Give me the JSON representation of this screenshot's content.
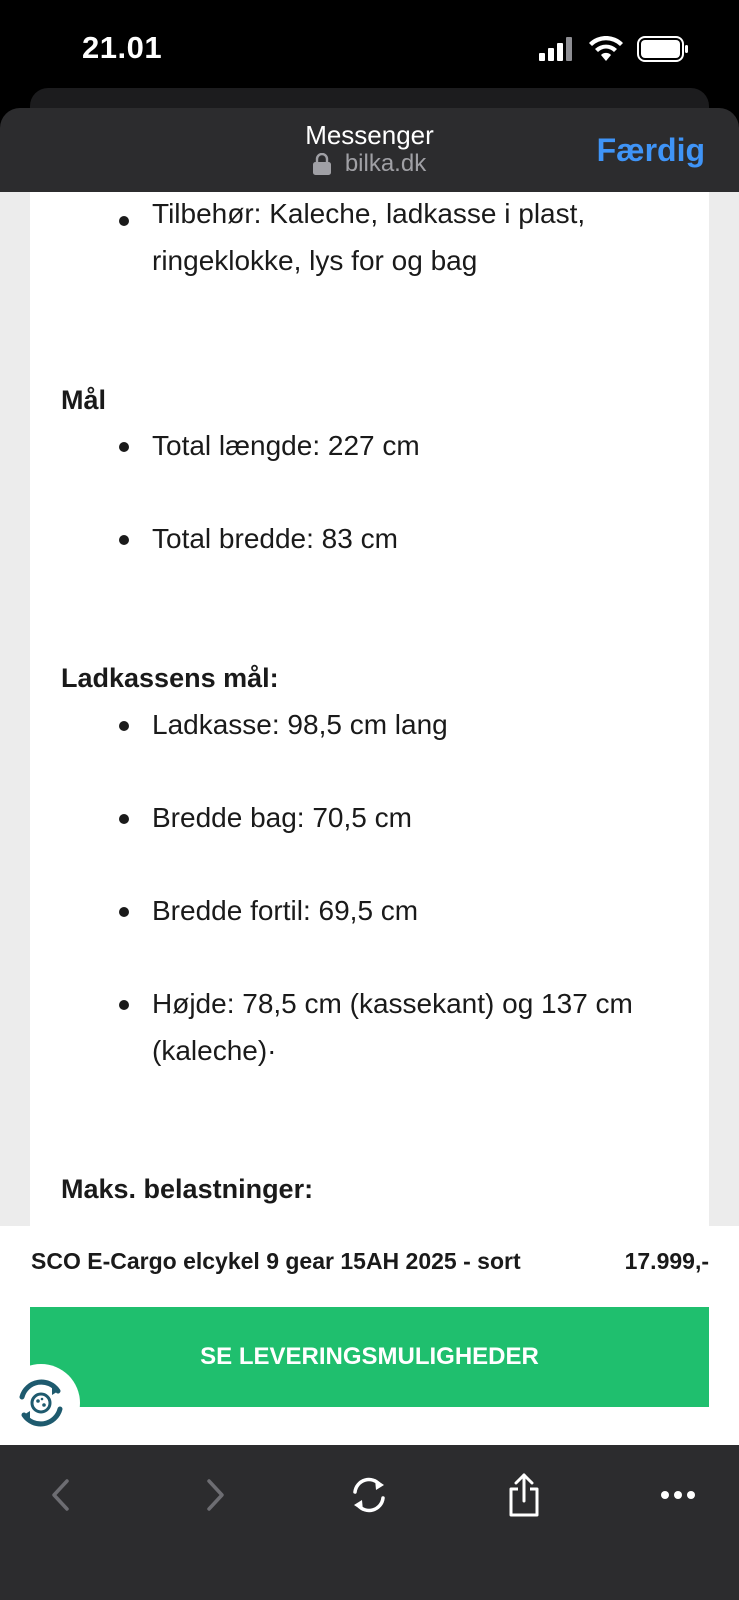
{
  "status_bar": {
    "time": "21.01"
  },
  "browser": {
    "title": "Messenger",
    "url": "bilka.dk",
    "done_label": "Færdig"
  },
  "content": {
    "accessories": "Tilbehør: Kaleche, ladkasse i plast, ringeklokke, lys for og bag",
    "dimensions_heading": "Mål",
    "dimensions": [
      "Total længde: 227 cm",
      "Total bredde: 83 cm"
    ],
    "box_heading": "Ladkassens mål:",
    "box_items": [
      "Ladkasse: 98,5 cm lang",
      "Bredde bag: 70,5 cm",
      "Bredde fortil: 69,5 cm",
      "Højde: 78,5 cm (kassekant) og 137 cm (kaleche)·"
    ],
    "load_heading": "Maks. belastninger:"
  },
  "product": {
    "name": "SCO E-Cargo elcykel 9 gear 15AH 2025 - sort",
    "price": "17.999,-",
    "cta_label": "SE LEVERINGSMULIGHEDER"
  },
  "colors": {
    "accent_blue": "#3f94f7",
    "cta_green": "#1fbf6e",
    "toolbar_bg": "#2c2c2e"
  }
}
